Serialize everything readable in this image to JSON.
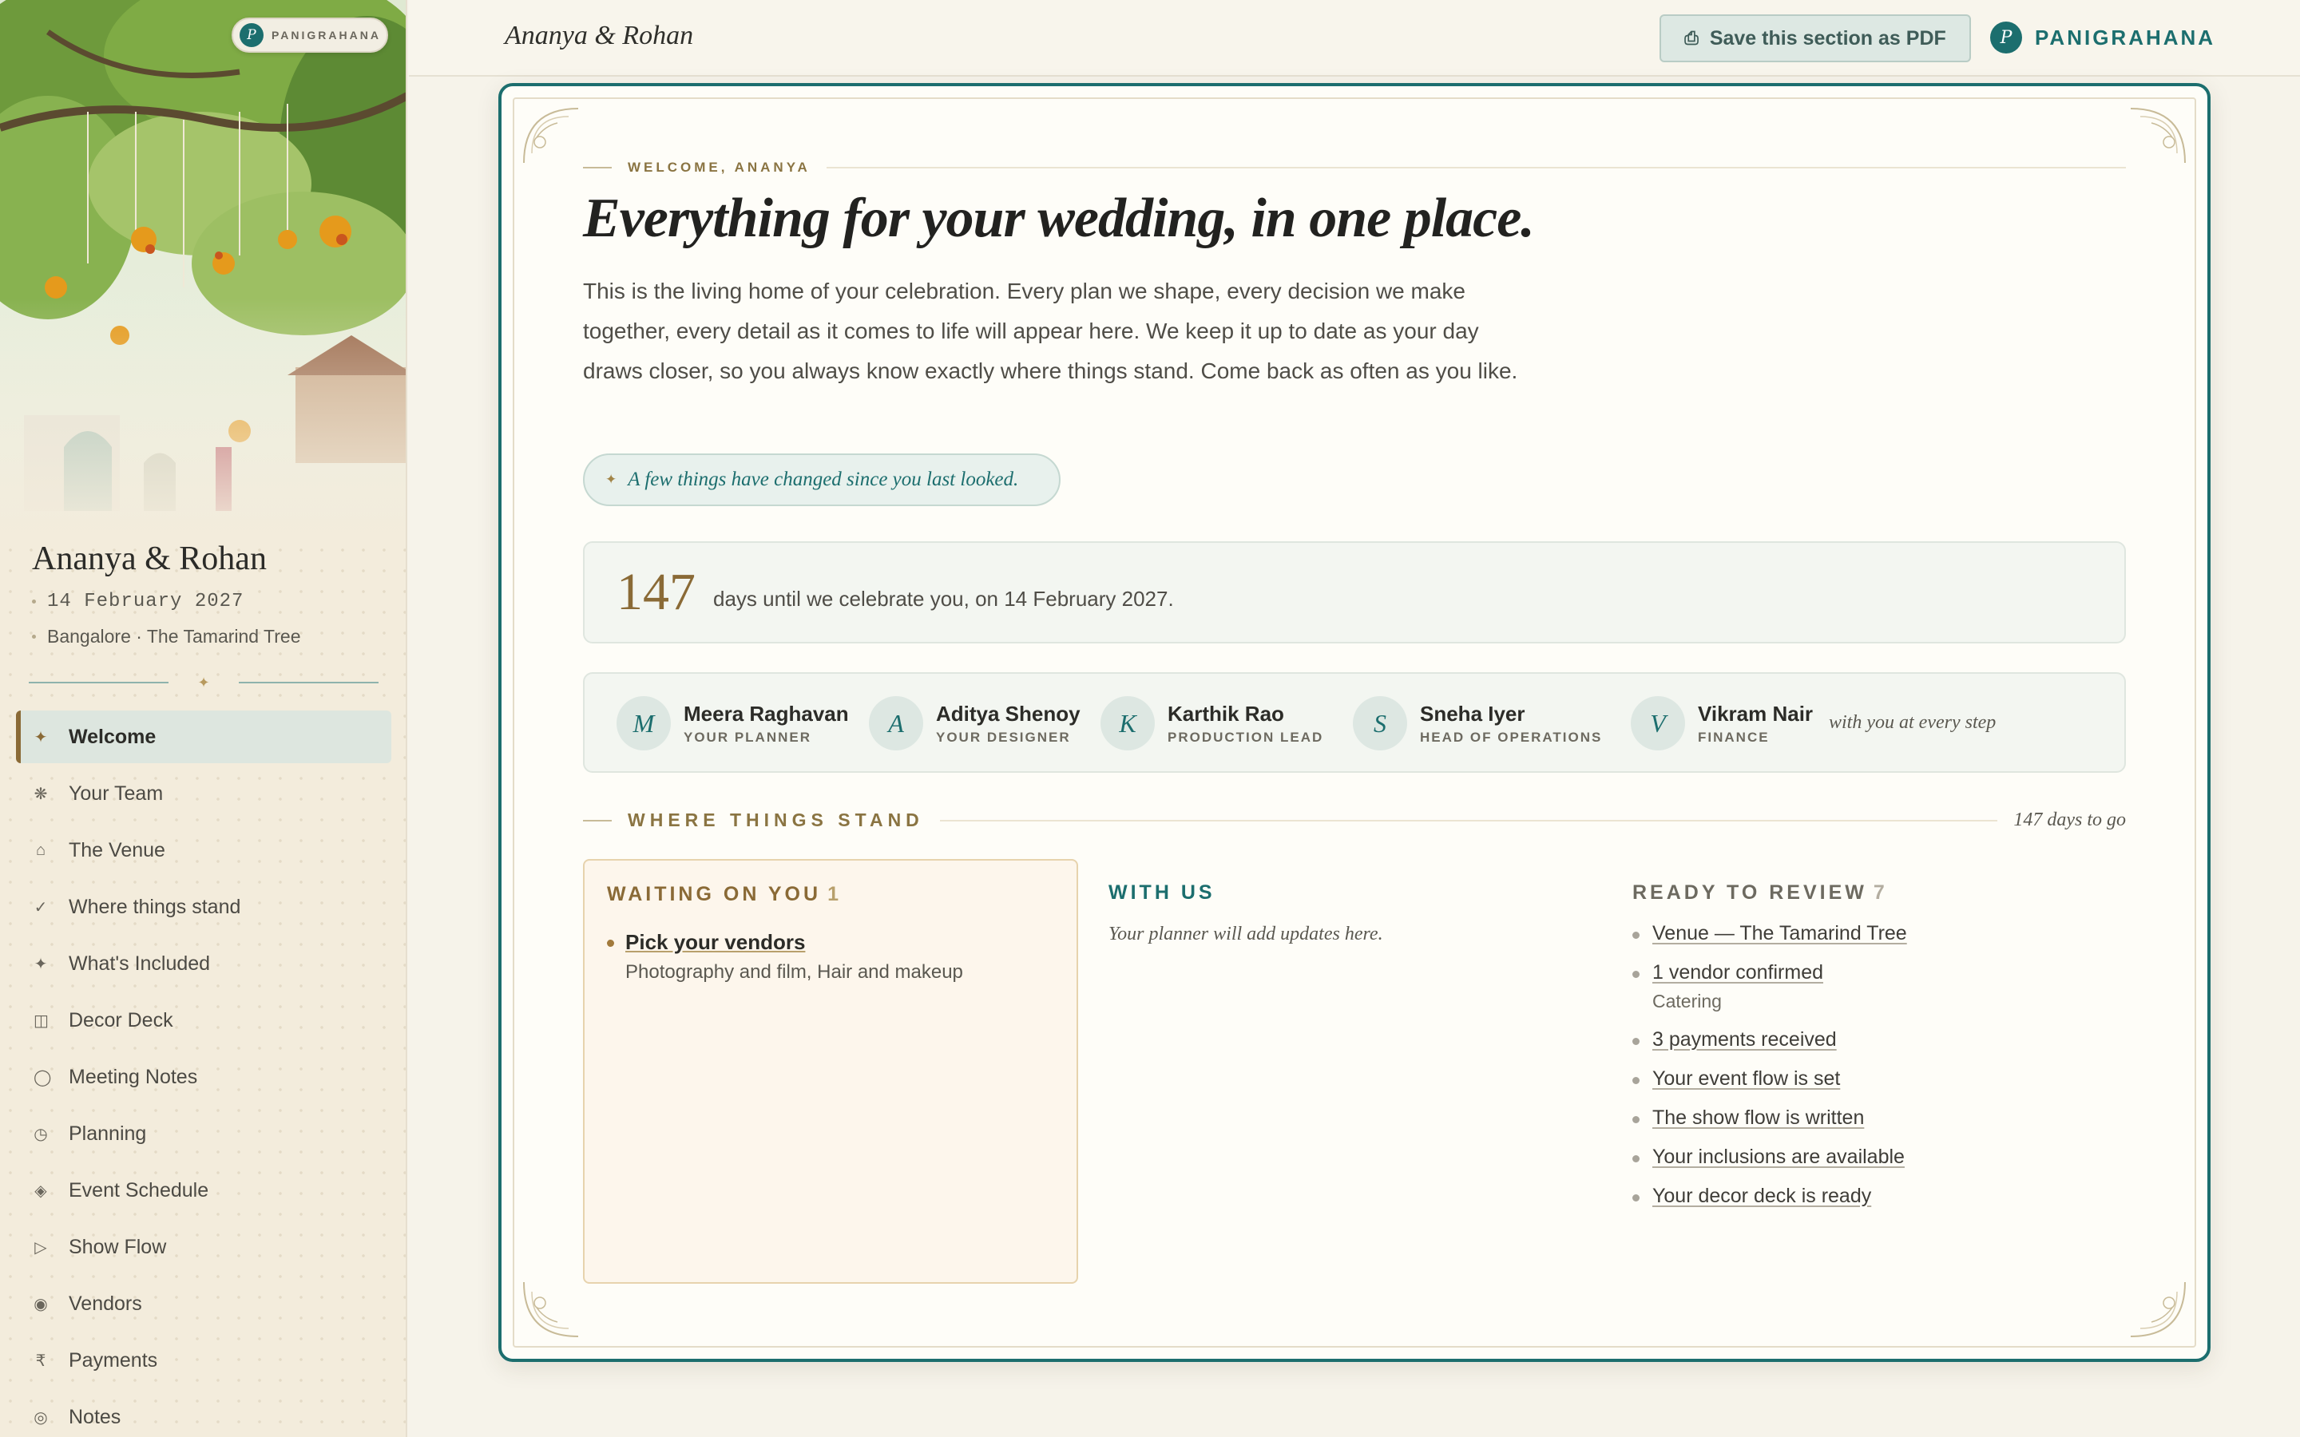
{
  "sidebar": {
    "badge": "PANIGRAHANA",
    "logo_letter": "P",
    "couple": "Ananya & Rohan",
    "date": "14 February 2027",
    "place": "Bangalore · The Tamarind Tree",
    "divider_star": "✦",
    "items": [
      {
        "label": "Welcome",
        "icon": "✦",
        "icon_name": "sparkle-icon",
        "active": true
      },
      {
        "label": "Your Team",
        "icon": "❋",
        "icon_name": "flower-icon"
      },
      {
        "label": "The Venue",
        "icon": "⌂",
        "icon_name": "home-icon"
      },
      {
        "label": "Where things stand",
        "icon": "✓",
        "icon_name": "check-icon"
      },
      {
        "label": "What's Included",
        "icon": "✦",
        "icon_name": "sparkle-icon"
      },
      {
        "label": "Decor Deck",
        "icon": "◫",
        "icon_name": "deck-icon"
      },
      {
        "label": "Meeting Notes",
        "icon": "◯",
        "icon_name": "circle-icon"
      },
      {
        "label": "Planning",
        "icon": "◷",
        "icon_name": "clock-icon"
      },
      {
        "label": "Event Schedule",
        "icon": "◈",
        "icon_name": "diamond-icon"
      },
      {
        "label": "Show Flow",
        "icon": "▷",
        "icon_name": "play-icon"
      },
      {
        "label": "Vendors",
        "icon": "◉",
        "icon_name": "target-icon"
      },
      {
        "label": "Payments",
        "icon": "₹",
        "icon_name": "rupee-icon"
      },
      {
        "label": "Notes",
        "icon": "◎",
        "icon_name": "notes-icon"
      }
    ]
  },
  "topbar": {
    "title": "Ananya & Rohan",
    "pdf_label": "Save this section as PDF",
    "pdf_icon": "⎙",
    "brand": "PANIGRAHANA",
    "logo_letter": "P"
  },
  "welcome": {
    "eyebrow": "WELCOME, ANANYA",
    "headline": "Everything for your wedding, in one place.",
    "intro": "This is the living home of your celebration. Every plan we shape, every decision we make together, every detail as it comes to life will appear here. We keep it up to date as your day draws closer, so you always know exactly where things stand. Come back as often as you like.",
    "changes": "A few things have changed since you last looked.",
    "star": "✦"
  },
  "countdown": {
    "days": "147",
    "text": "days until we celebrate you, on 14 February 2027."
  },
  "team": {
    "members": [
      {
        "initial": "M",
        "name": "Meera Raghavan",
        "role": "YOUR PLANNER"
      },
      {
        "initial": "A",
        "name": "Aditya Shenoy",
        "role": "YOUR DESIGNER"
      },
      {
        "initial": "K",
        "name": "Karthik Rao",
        "role": "PRODUCTION LEAD"
      },
      {
        "initial": "S",
        "name": "Sneha Iyer",
        "role": "HEAD OF OPERATIONS"
      },
      {
        "initial": "V",
        "name": "Vikram Nair",
        "role": "FINANCE"
      }
    ],
    "tagline": "with you at every step"
  },
  "status": {
    "heading": "WHERE THINGS STAND",
    "days_to_go": "147 days to go",
    "waiting": {
      "title": "WAITING ON YOU",
      "count": "1",
      "items": [
        {
          "label": "Pick your vendors",
          "sub": "Photography and film, Hair and makeup"
        }
      ]
    },
    "with_us": {
      "title": "WITH US",
      "empty": "Your planner will add updates here."
    },
    "review": {
      "title": "READY TO REVIEW",
      "count": "7",
      "items": [
        {
          "label": "Venue — The Tamarind Tree",
          "sub": ""
        },
        {
          "label": "1 vendor confirmed",
          "sub": "Catering"
        },
        {
          "label": "3 payments received",
          "sub": ""
        },
        {
          "label": "Your event flow is set",
          "sub": ""
        },
        {
          "label": "The show flow is written",
          "sub": ""
        },
        {
          "label": "Your inclusions are available",
          "sub": ""
        },
        {
          "label": "Your decor deck is ready",
          "sub": ""
        }
      ]
    }
  }
}
